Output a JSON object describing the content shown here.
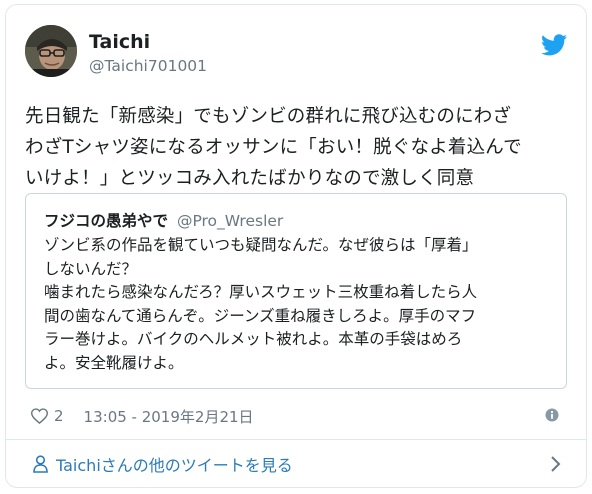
{
  "author": {
    "name": "Taichi",
    "handle": "@Taichi701001"
  },
  "tweet": {
    "text_lines": [
      "先日観た「新感染」でもゾンビの群れに飛び込むのにわざ",
      "わざTシャツ姿になるオッサンに「おい！脱ぐなよ着込んで",
      "いけよ！」とツッコみ入れたばかりなので激しく同意"
    ]
  },
  "quoted": {
    "name": "フジコの愚弟やで",
    "handle": "@Pro_Wresler",
    "text_lines": [
      "ゾンビ系の作品を観ていつも疑問なんだ。なぜ彼らは「厚着」",
      "しないんだ？",
      "噛まれたら感染なんだろ？厚いスウェット三枚重ね着したら人",
      "間の歯なんて通らんぞ。ジーンズ重ね履きしろよ。厚手のマフ",
      "ラー巻けよ。バイクのヘルメット被れよ。本革の手袋はめろ",
      "よ。安全靴履けよ。"
    ]
  },
  "meta": {
    "likes": "2",
    "timestamp": "13:05 - 2019年2月21日"
  },
  "footer": {
    "more_label": "Taichiさんの他のツイートを見る"
  },
  "colors": {
    "accent": "#2b7bb9",
    "twitter_blue": "#1da1f2",
    "muted": "#697882",
    "border": "#e1e8ed"
  }
}
